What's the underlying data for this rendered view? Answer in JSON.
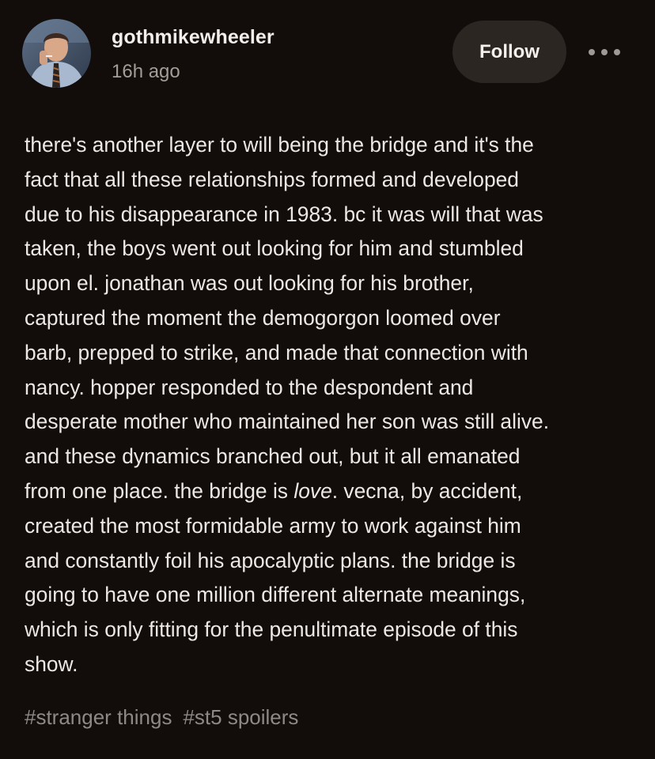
{
  "post": {
    "username": "gothmikewheeler",
    "timestamp": "16h ago",
    "follow_label": "Follow",
    "more_icon": "ellipsis-icon",
    "body_lines": [
      "there's another layer to will being the bridge and it's the",
      "fact that all these relationships formed and developed",
      "due to his disappearance in 1983. bc it was will that was",
      "taken, the boys went out looking for him and stumbled",
      "upon el. jonathan was out looking for his brother,",
      "captured the moment the demogorgon loomed over",
      "barb, prepped to strike, and made that connection with",
      "nancy. hopper responded to the despondent and",
      "desperate mother who maintained her son was still alive.",
      "and these dynamics branched out, but it all emanated"
    ],
    "love_line": {
      "before": "from one place. the bridge is ",
      "emphasis": "love",
      "after": ". vecna, by accident,"
    },
    "body_lines_end": [
      "created the most formidable army to work against him",
      "and constantly foil his apocalyptic plans. the bridge is",
      "going to have one million different alternate meanings,",
      "which is only fitting for the penultimate episode of this",
      "show."
    ],
    "tags": [
      "#stranger things",
      "#st5 spoilers"
    ]
  },
  "colors": {
    "background": "#120c0a",
    "text": "#ece8e4",
    "muted": "#a39d98",
    "button": "#2c2623"
  }
}
